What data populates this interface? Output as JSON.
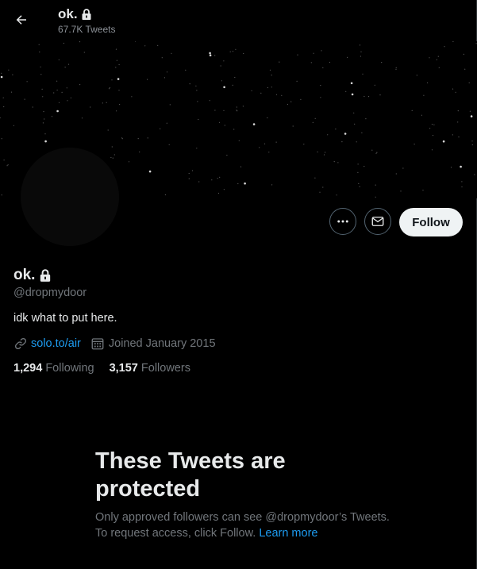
{
  "header": {
    "name": "ok.",
    "tweet_count": "67.7K Tweets"
  },
  "profile": {
    "name": "ok.",
    "handle": "@dropmydoor",
    "bio": "idk what to put here.",
    "link": "solo.to/air",
    "joined": "Joined January 2015",
    "following_count": "1,294",
    "following_label": "Following",
    "followers_count": "3,157",
    "followers_label": "Followers"
  },
  "actions": {
    "follow_label": "Follow"
  },
  "protected": {
    "title": "These Tweets are protected",
    "description": "Only approved followers can see @dropmydoor’s Tweets. To request access, click Follow.",
    "learn_more": "Learn more"
  },
  "icons": [
    "back-arrow-icon",
    "lock-icon",
    "more-icon",
    "message-icon",
    "link-icon",
    "calendar-icon"
  ],
  "colors": {
    "accent": "#1d9bf0",
    "background": "#000000",
    "follow_button": "#eff3f4",
    "secondary_text": "#71767b"
  }
}
